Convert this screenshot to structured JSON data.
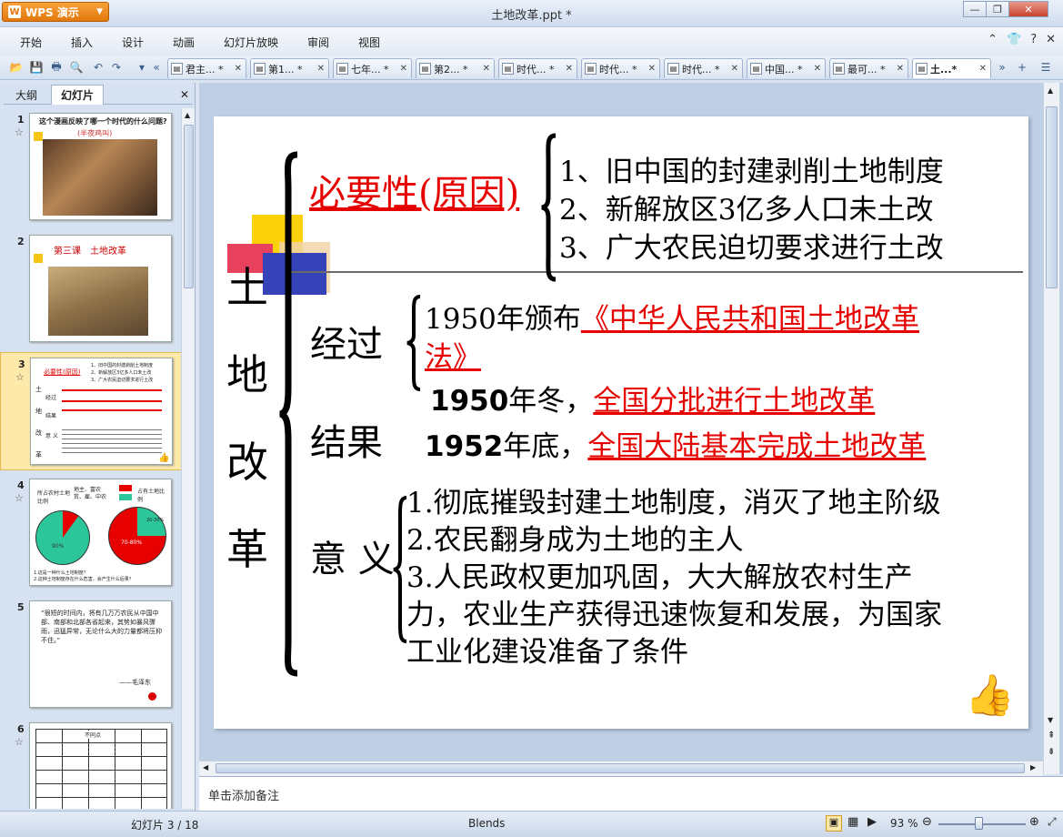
{
  "app": {
    "name": "WPS 演示",
    "window_title": "土地改革.ppt *"
  },
  "menu": [
    "开始",
    "插入",
    "设计",
    "动画",
    "幻灯片放映",
    "审阅",
    "视图"
  ],
  "tabs": [
    {
      "label": "君主... *"
    },
    {
      "label": "第1... *"
    },
    {
      "label": "七年... *"
    },
    {
      "label": "第2... *"
    },
    {
      "label": "时代... *"
    },
    {
      "label": "时代... *"
    },
    {
      "label": "时代... *"
    },
    {
      "label": "中国... *"
    },
    {
      "label": "最可... *"
    },
    {
      "label": "土...*"
    }
  ],
  "left_panel": {
    "tab_outline": "大纲",
    "tab_slides": "幻灯片"
  },
  "thumbs": {
    "t1_title": "这个漫画反映了哪一个时代的什么问题?",
    "t1_sub": "(半夜鸡叫)",
    "t2_title": "第三课　土地改革",
    "t3_lines": [
      "1、旧中国的封建剥削土地制度",
      "2、新解放区3亿多人口未土改",
      "3、广大农民迫切要求进行土改"
    ],
    "t4_labels": [
      "所占农村土地比例",
      "地主、富农",
      "贫、雇、中农",
      "占有土地比例",
      "20-30%",
      "90%",
      "70-80%",
      "10%"
    ],
    "t4_questions": [
      "1.这是一种什么土地制度？",
      "2.这种土地制度存在什么危害，会产生什么后果？"
    ],
    "t5_quote": "“很短的时间内，将有几万万农民从中国中部、南部和北部各省起来，其势如暴风骤雨，迅猛异常，无论什么大的力量都将压抑不住。”",
    "t5_author": "——毛泽东",
    "t6_header": "不同点"
  },
  "slide": {
    "vertical_title": [
      "土",
      "地",
      "改",
      "革"
    ],
    "necessity_label": "必要性(原因)",
    "reasons": [
      "1、旧中国的封建剥削土地制度",
      "2、新解放区3亿多人口未土改",
      "3、广大农民迫切要求进行土改"
    ],
    "process_label": "经过",
    "law_year": "1950年颁布",
    "law_name_1": "《中华人民共和国土地改革",
    "law_name_2": "法》",
    "winter_year": "1950",
    "winter_suffix": "年冬，",
    "winter_event": "全国分批进行土地改革",
    "result_label": "结果",
    "end_year": "1952",
    "end_suffix": "年底，",
    "end_event": "全国大陆基本完成土地改革",
    "meaning_label": "意 义",
    "meanings": [
      "1.彻底摧毁封建土地制度，消灭了地主阶级",
      "2.农民翻身成为土地的主人",
      "3.人民政权更加巩固，大大解放农村生产",
      "力，农业生产获得迅速恢复和发展，为国家",
      "工业化建设准备了条件"
    ]
  },
  "notes_placeholder": "单击添加备注",
  "status": {
    "slide_counter": "幻灯片 3 / 18",
    "theme": "Blends",
    "zoom": "93 %"
  },
  "colors": {
    "accent_red": "#e60000",
    "app_orange": "#e2780d"
  }
}
